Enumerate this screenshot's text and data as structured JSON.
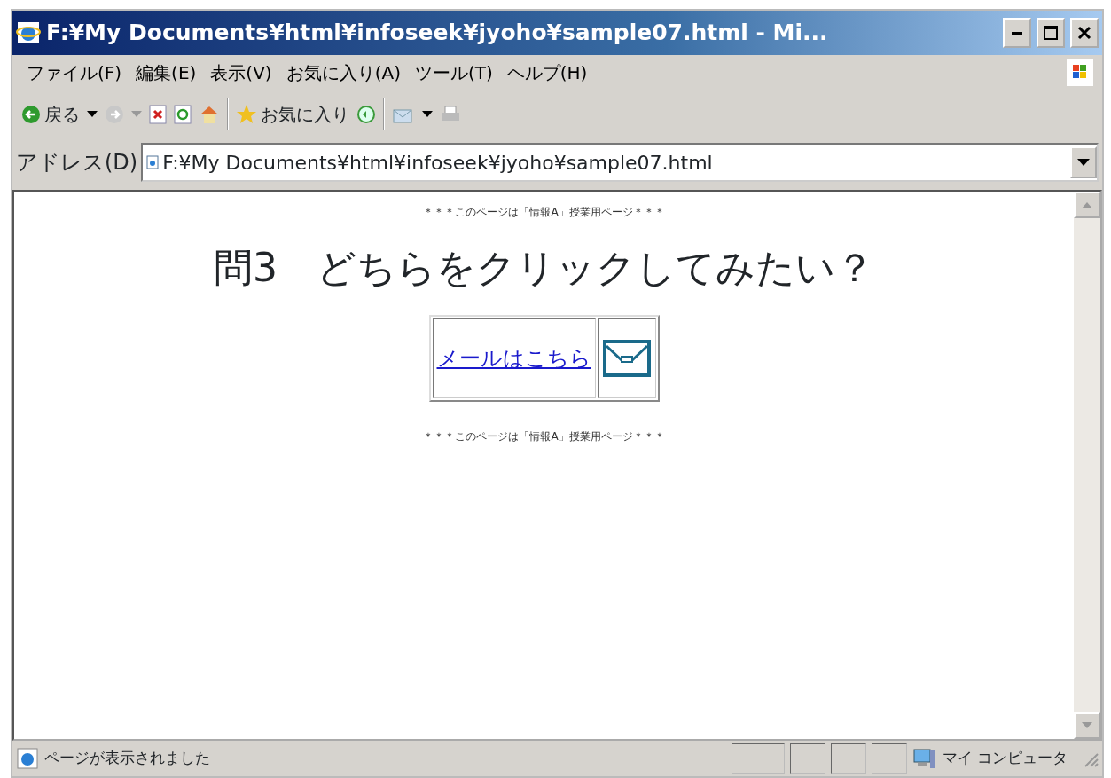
{
  "window": {
    "title": "F:¥My Documents¥html¥infoseek¥jyoho¥sample07.html - Mi..."
  },
  "menu": [
    "ファイル(F)",
    "編集(E)",
    "表示(V)",
    "お気に入り(A)",
    "ツール(T)",
    "ヘルプ(H)"
  ],
  "toolbar": {
    "back_label": "戻る",
    "favorites_label": "お気に入り"
  },
  "address": {
    "label": "アドレス(D)",
    "value": "F:¥My Documents¥html¥infoseek¥jyoho¥sample07.html"
  },
  "page": {
    "notice_top": "＊＊＊このページは「情報A」授業用ページ＊＊＊",
    "heading": "問3　どちらをクリックしてみたい？",
    "link": "メールはこちら",
    "notice_bottom": "＊＊＊このページは「情報A」授業用ページ＊＊＊"
  },
  "status_bar": {
    "text": "ページが表示されました",
    "zone": "マイ コンピュータ"
  }
}
